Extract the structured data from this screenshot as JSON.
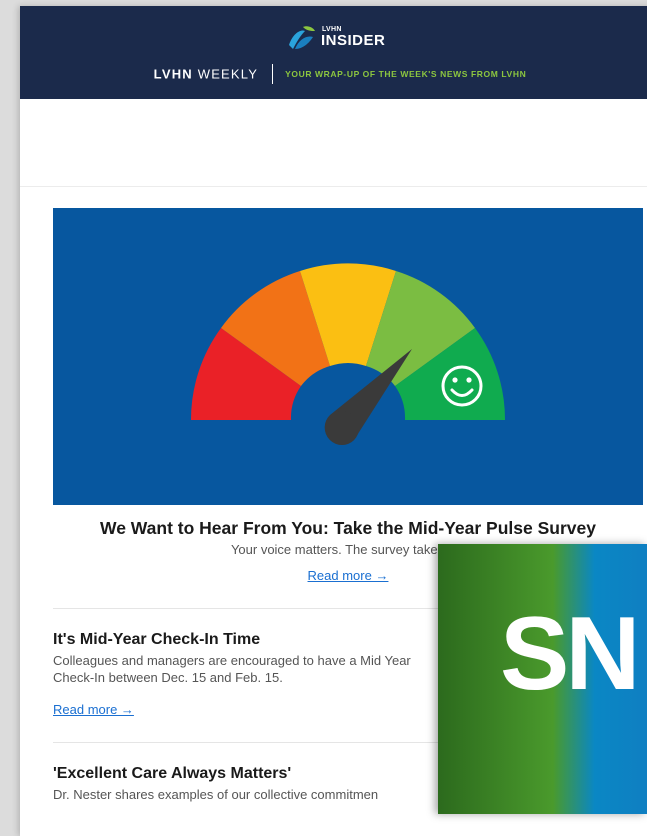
{
  "header": {
    "logo_small": "LVHN",
    "logo_big": "INSIDER",
    "weekly_brand": "LVHN",
    "weekly_word": "WEEKLY",
    "tagline": "YOUR WRAP-UP OF THE WEEK'S NEWS FROM LVHN"
  },
  "hero": {
    "title": "We Want to Hear From You: Take the Mid-Year Pulse Survey",
    "subtitle": "Your voice matters. The survey takes pla",
    "read_more": "Read more →",
    "gauge_colors": [
      "#ea2127",
      "#f27216",
      "#fbbf12",
      "#7bbd42",
      "#10ab4f"
    ],
    "background": "#07579f"
  },
  "items": [
    {
      "title": "It's Mid-Year Check-In Time",
      "body": "Colleagues and managers are encouraged to have a Mid Year Check-In between Dec. 15 and Feb. 15.",
      "read_more": "Read more →"
    },
    {
      "title": "'Excellent Care Always Matters'",
      "body": "Dr. Nester shares examples of our collective commitmen"
    }
  ],
  "overlay": {
    "text": "SN"
  }
}
